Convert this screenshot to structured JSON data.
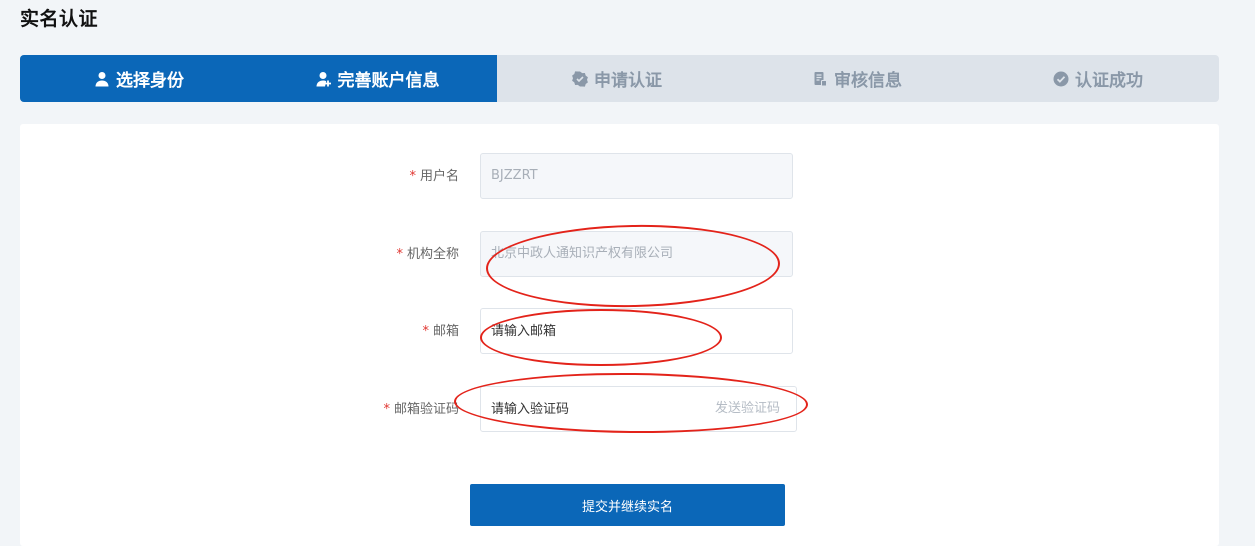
{
  "page": {
    "title": "实名认证"
  },
  "steps": [
    {
      "label": "选择身份",
      "icon": "user-icon",
      "active": true
    },
    {
      "label": "完善账户信息",
      "icon": "user-add-icon",
      "active": true
    },
    {
      "label": "申请认证",
      "icon": "badge-icon",
      "active": false
    },
    {
      "label": "审核信息",
      "icon": "document-icon",
      "active": false
    },
    {
      "label": "认证成功",
      "icon": "check-circle-icon",
      "active": false
    }
  ],
  "form": {
    "username": {
      "label": "用户名",
      "value": "BJZZRT"
    },
    "org_name": {
      "label": "机构全称",
      "value": "北京中政人通知识产权有限公司"
    },
    "email": {
      "label": "邮箱",
      "placeholder": "请输入邮箱"
    },
    "email_code": {
      "label": "邮箱验证码",
      "placeholder": "请输入验证码",
      "send_label": "发送验证码"
    },
    "required_mark": "*",
    "submit_label": "提交并继续实名"
  },
  "colors": {
    "primary": "#0b67b8",
    "step_inactive_bg": "#dde3ea",
    "required": "#e0342f",
    "annotation": "#e3231a"
  }
}
